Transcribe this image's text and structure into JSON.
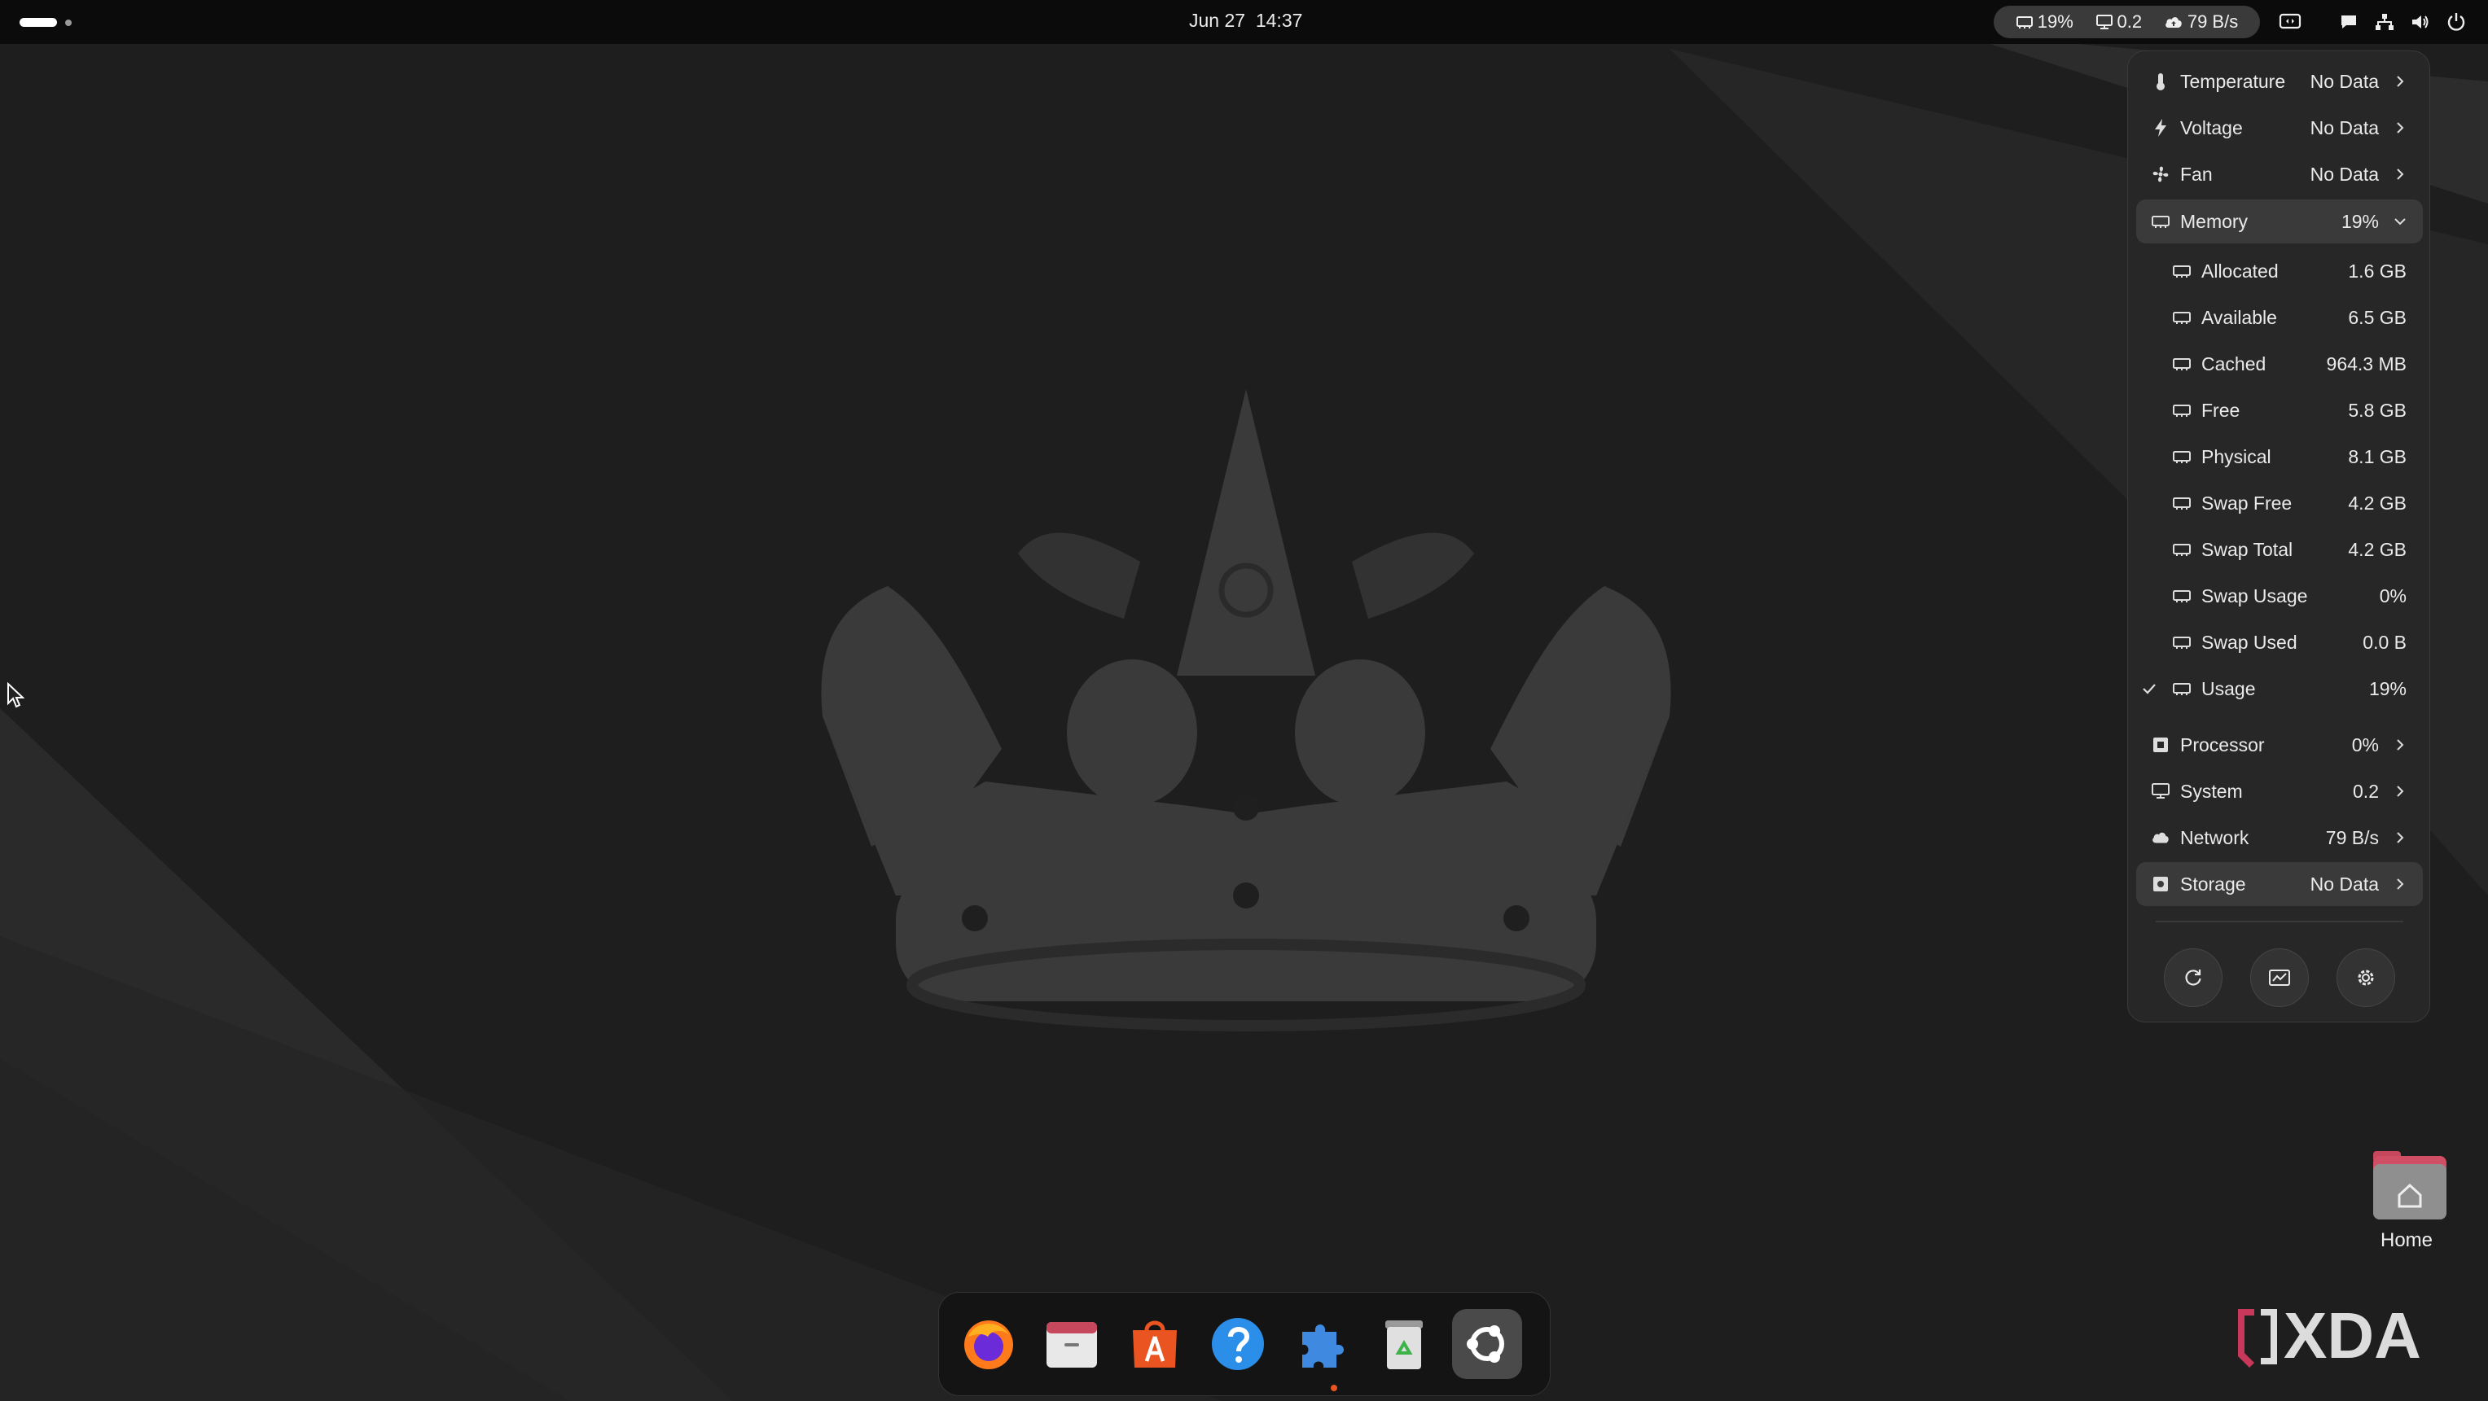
{
  "topbar": {
    "date": "Jun 27",
    "time": "14:37",
    "indicators": [
      {
        "icon": "memory-chip-icon",
        "text": "19%"
      },
      {
        "icon": "monitor-icon",
        "text": "0.2"
      },
      {
        "icon": "cloud-upload-icon",
        "text": "79 B/s"
      }
    ],
    "tray": [
      "screen-share-icon",
      "chat-icon",
      "network-wired-icon",
      "volume-icon",
      "power-icon"
    ]
  },
  "popup": {
    "rows": [
      {
        "name": "temperature",
        "icon": "thermometer-icon",
        "label": "Temperature",
        "value": "No Data"
      },
      {
        "name": "voltage",
        "icon": "lightning-icon",
        "label": "Voltage",
        "value": "No Data"
      },
      {
        "name": "fan",
        "icon": "fan-icon",
        "label": "Fan",
        "value": "No Data"
      },
      {
        "name": "memory",
        "icon": "memory-chip-icon",
        "label": "Memory",
        "value": "19%",
        "expanded": true
      },
      {
        "name": "processor",
        "icon": "cpu-icon",
        "label": "Processor",
        "value": "0%"
      },
      {
        "name": "system",
        "icon": "monitor-icon",
        "label": "System",
        "value": "0.2"
      },
      {
        "name": "network",
        "icon": "cloud-icon",
        "label": "Network",
        "value": "79 B/s"
      },
      {
        "name": "storage",
        "icon": "disk-icon",
        "label": "Storage",
        "value": "No Data"
      }
    ],
    "memory_items": [
      {
        "label": "Allocated",
        "value": "1.6 GB"
      },
      {
        "label": "Available",
        "value": "6.5 GB"
      },
      {
        "label": "Cached",
        "value": "964.3 MB"
      },
      {
        "label": "Free",
        "value": "5.8 GB"
      },
      {
        "label": "Physical",
        "value": "8.1 GB"
      },
      {
        "label": "Swap Free",
        "value": "4.2 GB"
      },
      {
        "label": "Swap Total",
        "value": "4.2 GB"
      },
      {
        "label": "Swap Usage",
        "value": "0%"
      },
      {
        "label": "Swap Used",
        "value": "0.0 B"
      },
      {
        "label": "Usage",
        "value": "19%",
        "checked": true
      }
    ],
    "buttons": [
      "refresh-icon",
      "system-monitor-icon",
      "settings-gear-icon"
    ]
  },
  "dock": {
    "apps": [
      "firefox",
      "files",
      "app-center",
      "help",
      "extension-manager",
      "trash",
      "ubuntu-show-apps"
    ]
  },
  "desktop": {
    "home_label": "Home",
    "watermark": "XDA"
  },
  "colors": {
    "accent": "#e95420",
    "panel": "#272727",
    "topbar": "#0b0b0b",
    "highlight": "#3a3a3a"
  }
}
